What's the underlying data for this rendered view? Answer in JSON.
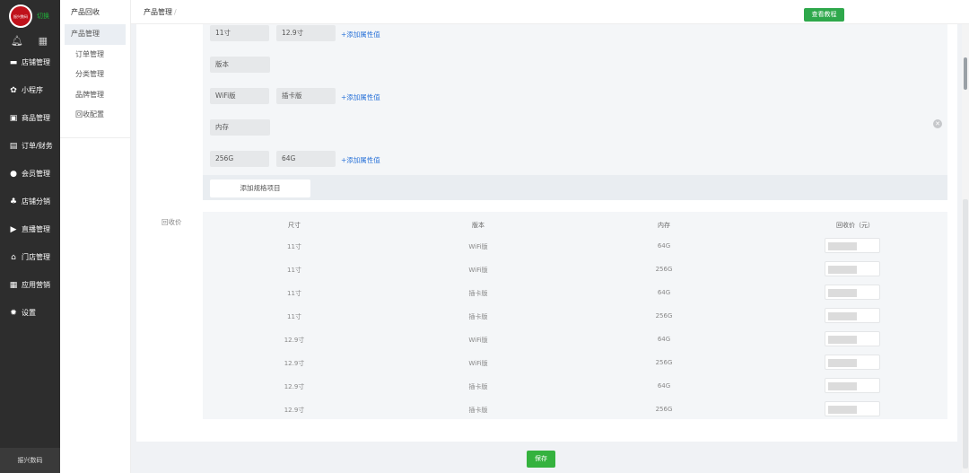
{
  "sidebar": {
    "logo_text": "振兴数码",
    "switch_label": "切换",
    "items": [
      {
        "label": "店铺管理",
        "icon": "store-icon"
      },
      {
        "label": "小程序",
        "icon": "miniprogram-icon"
      },
      {
        "label": "商品管理",
        "icon": "goods-icon"
      },
      {
        "label": "订单/财务",
        "icon": "order-icon"
      },
      {
        "label": "会员管理",
        "icon": "member-icon"
      },
      {
        "label": "店铺分销",
        "icon": "distribution-icon"
      },
      {
        "label": "直播管理",
        "icon": "live-icon"
      },
      {
        "label": "门店管理",
        "icon": "shop-icon"
      },
      {
        "label": "应用营销",
        "icon": "apps-icon"
      },
      {
        "label": "设置",
        "icon": "gear-icon"
      }
    ],
    "footer": "振兴数码"
  },
  "subside": {
    "title": "产品回收",
    "items": [
      "产品管理",
      "订单管理",
      "分类管理",
      "品牌管理",
      "回收配置"
    ],
    "active": "产品管理"
  },
  "header": {
    "breadcrumb": "产品管理",
    "breadcrumb_sep": "/",
    "tutorial_button": "查看教程"
  },
  "spec": {
    "add_value_link": "+添加属性值",
    "add_spec_button": "添加规格项目",
    "groups": [
      {
        "name": null,
        "values": [
          "11寸",
          "12.9寸"
        ]
      },
      {
        "name": "版本",
        "values": [
          "WiFi版",
          "插卡版"
        ]
      },
      {
        "name": "内存",
        "values": [
          "256G",
          "64G"
        ]
      }
    ]
  },
  "pricing": {
    "label": "回收价",
    "columns": [
      "尺寸",
      "版本",
      "内存",
      "回收价（元）"
    ],
    "rows": [
      [
        "11寸",
        "WiFi版",
        "64G"
      ],
      [
        "11寸",
        "WiFi版",
        "256G"
      ],
      [
        "11寸",
        "插卡版",
        "64G"
      ],
      [
        "11寸",
        "插卡版",
        "256G"
      ],
      [
        "12.9寸",
        "WiFi版",
        "64G"
      ],
      [
        "12.9寸",
        "WiFi版",
        "256G"
      ],
      [
        "12.9寸",
        "插卡版",
        "64G"
      ],
      [
        "12.9寸",
        "插卡版",
        "256G"
      ]
    ]
  },
  "save_button": "保存",
  "colors": {
    "accent_green": "#2ea84b",
    "link_blue": "#2c74d9",
    "sidebar_bg": "#2d2d2d",
    "logo_red": "#c0121b"
  }
}
